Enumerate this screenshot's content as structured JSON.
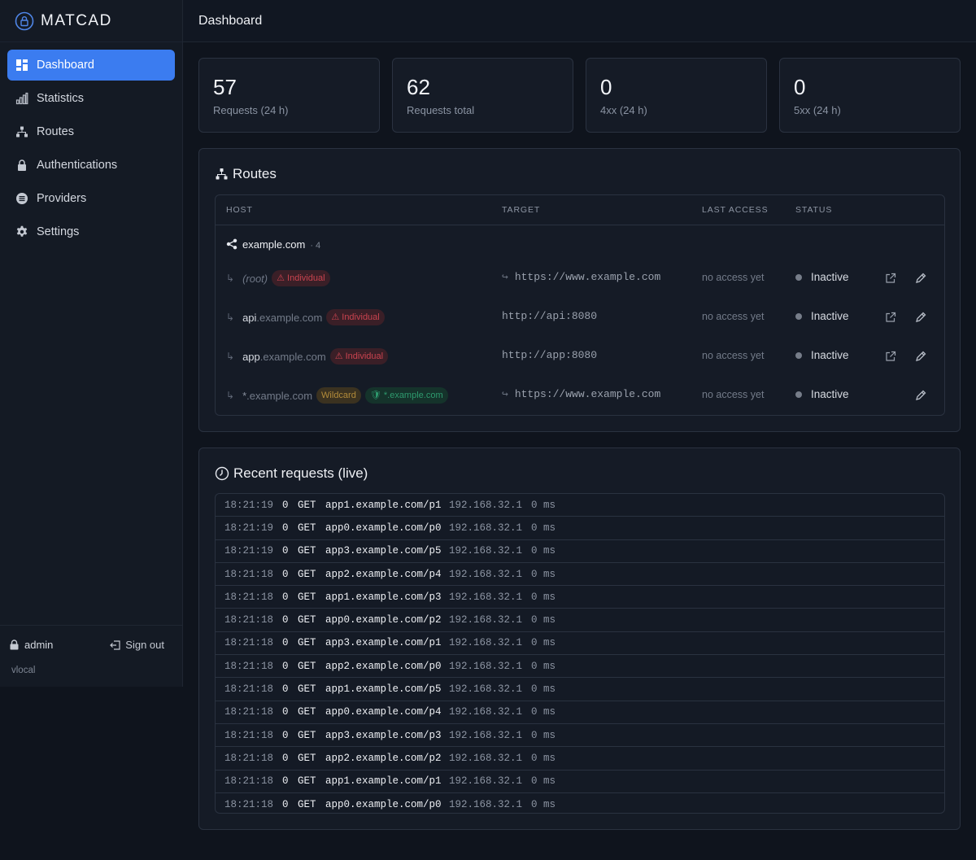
{
  "brand": {
    "name": "MATCAD"
  },
  "page": {
    "title": "Dashboard"
  },
  "sidebar": {
    "items": [
      {
        "label": "Dashboard",
        "icon": "dashboard-icon",
        "active": true
      },
      {
        "label": "Statistics",
        "icon": "bar-chart-icon"
      },
      {
        "label": "Routes",
        "icon": "sitemap-icon"
      },
      {
        "label": "Authentications",
        "icon": "lock-icon"
      },
      {
        "label": "Providers",
        "icon": "list-circle-icon"
      },
      {
        "label": "Settings",
        "icon": "gear-icon"
      }
    ],
    "user": "admin",
    "sign_out": "Sign out",
    "host": "vlocal"
  },
  "stats": [
    {
      "value": "57",
      "label": "Requests (24 h)"
    },
    {
      "value": "62",
      "label": "Requests total"
    },
    {
      "value": "0",
      "label": "4xx (24 h)"
    },
    {
      "value": "0",
      "label": "5xx (24 h)"
    }
  ],
  "routes": {
    "title": "Routes",
    "columns": {
      "host": "HOST",
      "target": "TARGET",
      "last_access": "LAST ACCESS",
      "status": "STATUS"
    },
    "group": {
      "domain": "example.com",
      "count": "· 4"
    },
    "rows": [
      {
        "host_sub": "(root)",
        "host_base": "",
        "badges": [
          {
            "text": "⚠ Individual",
            "kind": "red"
          }
        ],
        "target_arrow": "↪",
        "target": "https://www.example.com",
        "last_access": "no access yet",
        "status": "Inactive",
        "open": true
      },
      {
        "host_sub": "api",
        "host_base": ".example.com",
        "badges": [
          {
            "text": "⚠ Individual",
            "kind": "red"
          }
        ],
        "target_arrow": "",
        "target": "http://api:8080",
        "last_access": "no access yet",
        "status": "Inactive",
        "open": true
      },
      {
        "host_sub": "app",
        "host_base": ".example.com",
        "badges": [
          {
            "text": "⚠ Individual",
            "kind": "red"
          }
        ],
        "target_arrow": "",
        "target": "http://app:8080",
        "last_access": "no access yet",
        "status": "Inactive",
        "open": true
      },
      {
        "host_sub": "*",
        "host_base": ".example.com",
        "badges": [
          {
            "text": "Wildcard",
            "kind": "yellow"
          },
          {
            "text": "🛡 *.example.com",
            "kind": "green"
          }
        ],
        "target_arrow": "↪",
        "target": "https://www.example.com",
        "last_access": "no access yet",
        "status": "Inactive",
        "open": false
      }
    ]
  },
  "requests": {
    "title": "Recent requests (live)",
    "rows": [
      {
        "time": "18:21:19",
        "status": "0",
        "method": "GET",
        "path": "app1.example.com/p1",
        "ip": "192.168.32.1",
        "duration": "0 ms"
      },
      {
        "time": "18:21:19",
        "status": "0",
        "method": "GET",
        "path": "app0.example.com/p0",
        "ip": "192.168.32.1",
        "duration": "0 ms"
      },
      {
        "time": "18:21:19",
        "status": "0",
        "method": "GET",
        "path": "app3.example.com/p5",
        "ip": "192.168.32.1",
        "duration": "0 ms"
      },
      {
        "time": "18:21:18",
        "status": "0",
        "method": "GET",
        "path": "app2.example.com/p4",
        "ip": "192.168.32.1",
        "duration": "0 ms"
      },
      {
        "time": "18:21:18",
        "status": "0",
        "method": "GET",
        "path": "app1.example.com/p3",
        "ip": "192.168.32.1",
        "duration": "0 ms"
      },
      {
        "time": "18:21:18",
        "status": "0",
        "method": "GET",
        "path": "app0.example.com/p2",
        "ip": "192.168.32.1",
        "duration": "0 ms"
      },
      {
        "time": "18:21:18",
        "status": "0",
        "method": "GET",
        "path": "app3.example.com/p1",
        "ip": "192.168.32.1",
        "duration": "0 ms"
      },
      {
        "time": "18:21:18",
        "status": "0",
        "method": "GET",
        "path": "app2.example.com/p0",
        "ip": "192.168.32.1",
        "duration": "0 ms"
      },
      {
        "time": "18:21:18",
        "status": "0",
        "method": "GET",
        "path": "app1.example.com/p5",
        "ip": "192.168.32.1",
        "duration": "0 ms"
      },
      {
        "time": "18:21:18",
        "status": "0",
        "method": "GET",
        "path": "app0.example.com/p4",
        "ip": "192.168.32.1",
        "duration": "0 ms"
      },
      {
        "time": "18:21:18",
        "status": "0",
        "method": "GET",
        "path": "app3.example.com/p3",
        "ip": "192.168.32.1",
        "duration": "0 ms"
      },
      {
        "time": "18:21:18",
        "status": "0",
        "method": "GET",
        "path": "app2.example.com/p2",
        "ip": "192.168.32.1",
        "duration": "0 ms"
      },
      {
        "time": "18:21:18",
        "status": "0",
        "method": "GET",
        "path": "app1.example.com/p1",
        "ip": "192.168.32.1",
        "duration": "0 ms"
      },
      {
        "time": "18:21:18",
        "status": "0",
        "method": "GET",
        "path": "app0.example.com/p0",
        "ip": "192.168.32.1",
        "duration": "0 ms"
      }
    ]
  },
  "colors": {
    "accent": "#3b7cf0",
    "background": "#0f141d",
    "panel": "#151b26",
    "danger": "#c9434f",
    "warning": "#b28b3a",
    "success": "#2e9a6e"
  }
}
